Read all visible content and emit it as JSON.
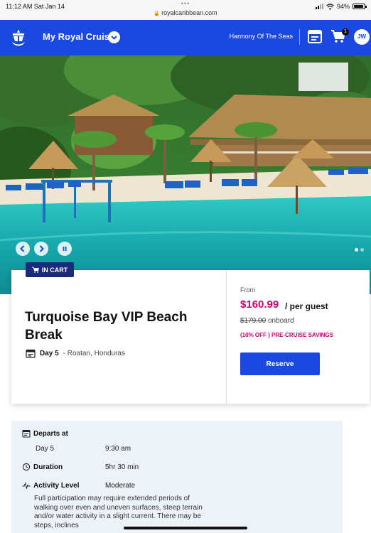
{
  "status_bar": {
    "time": "11:12 AM  Sat Jan 14",
    "dots": "•••",
    "url": "royalcaribbean.com",
    "battery": "94%"
  },
  "header": {
    "title": "My Royal Cruise",
    "ship": "Harmony Of The Seas",
    "cart_count": "1",
    "avatar_initials": "JW",
    "brand_color": "#1a48e0"
  },
  "hero": {
    "image_icon": "beach-photo",
    "controls": [
      "prev-icon",
      "next-icon",
      "pause-icon"
    ]
  },
  "product": {
    "in_cart_label": "IN CART",
    "title": "Turquoise Bay VIP Beach Break",
    "day": "Day 5",
    "port": "- Roatan, Honduras",
    "from_label": "From",
    "price": "$160.99",
    "per_guest": "/ per guest",
    "original_price": "$179.00",
    "onboard_label": "onboard",
    "discount": "(10% OFF )",
    "savings_label": "PRE-CRUISE SAVINGS",
    "reserve_label": "Reserve",
    "accent_color": "#d6006d"
  },
  "details": {
    "departs_label": "Departs at",
    "departs_day": "Day 5",
    "departs_time": "9:30 am",
    "duration_label": "Duration",
    "duration_value": "5hr 30 min",
    "activity_label": "Activity Level",
    "activity_value": "Moderate",
    "activity_description": "Full participation may require extended periods of walking over even and uneven surfaces, steep terrain and/or water activity in a slight current. There may be steps, inclines"
  }
}
